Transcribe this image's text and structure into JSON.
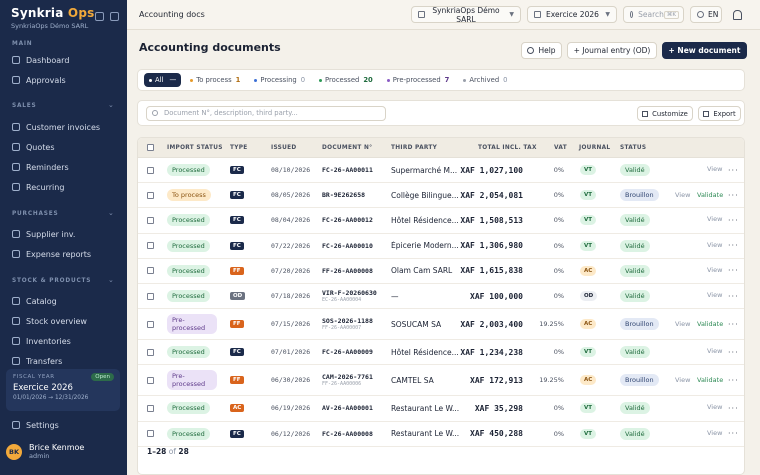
{
  "brand": {
    "name_a": "Synkria",
    "name_b": "Ops",
    "org": "SynkriaOps Démo SARL"
  },
  "sidebar": {
    "sections": [
      {
        "label": "MAIN"
      },
      {
        "label": "SALES"
      },
      {
        "label": "PURCHASES"
      },
      {
        "label": "STOCK & PRODUCTS"
      }
    ],
    "items": [
      {
        "label": "Dashboard",
        "icon": "grid-icon"
      },
      {
        "label": "Approvals",
        "icon": "check-icon"
      },
      {
        "label": "Customer invoices",
        "icon": "file-icon"
      },
      {
        "label": "Quotes",
        "icon": "quote-icon"
      },
      {
        "label": "Reminders",
        "icon": "bell-icon"
      },
      {
        "label": "Recurring",
        "icon": "repeat-icon"
      },
      {
        "label": "Supplier inv.",
        "icon": "file-icon"
      },
      {
        "label": "Expense reports",
        "icon": "receipt-icon"
      },
      {
        "label": "Catalog",
        "icon": "box-icon"
      },
      {
        "label": "Stock overview",
        "icon": "layers-icon"
      },
      {
        "label": "Inventories",
        "icon": "clipboard-icon"
      },
      {
        "label": "Transfers",
        "icon": "transfer-icon"
      },
      {
        "label": "Settings",
        "icon": "gear-icon"
      }
    ],
    "fiscal": {
      "label": "FISCAL YEAR",
      "name": "Exercice 2026",
      "dates": "01/01/2026 → 12/31/2026",
      "badge": "Open"
    },
    "user": {
      "initials": "BK",
      "name": "Brice Kenmoe",
      "role": "admin"
    }
  },
  "topbar": {
    "breadcrumb": "Accounting docs",
    "company": "SynkriaOps Démo SARL",
    "year": "Exercice 2026",
    "search_placeholder": "Search",
    "search_kbd": "⌘K",
    "lang": "EN"
  },
  "page": {
    "title": "Accounting documents",
    "help": "Help",
    "journal_entry": "+ Journal entry (OD)",
    "new_document": "+ New document"
  },
  "tabs": [
    {
      "label": "All",
      "count": "",
      "color": "#ffffff"
    },
    {
      "label": "To process",
      "count": "1",
      "color": "#e59a2a"
    },
    {
      "label": "Processing",
      "count": "0",
      "color": "#3b6fd6"
    },
    {
      "label": "Processed",
      "count": "20",
      "color": "#2e9a57"
    },
    {
      "label": "Pre-processed",
      "count": "7",
      "color": "#8a5bc4"
    },
    {
      "label": "Archived",
      "count": "0",
      "color": "#9aa0ab"
    }
  ],
  "filters": {
    "search_placeholder": "Document N°, description, third party...",
    "customize": "Customize",
    "export": "Export"
  },
  "table": {
    "headers": {
      "import_status": "IMPORT STATUS",
      "type": "TYPE",
      "issued": "ISSUED",
      "document": "DOCUMENT N°",
      "third_party": "THIRD PARTY",
      "total": "TOTAL INCL. TAX",
      "vat": "VAT",
      "journal": "JOURNAL",
      "status": "STATUS"
    },
    "rows": [
      {
        "import": "Processed",
        "import_kind": "processed",
        "type": "FC",
        "type_color": "#1b2a4a",
        "issued": "08/10/2026",
        "doc": "FC-26-AA00011",
        "doc_sub": "",
        "third": "Supermarché M...",
        "total": "XAF 1,027,100",
        "vat": "0%",
        "journal": "VT",
        "journal_kind": "vt",
        "status": "Validé",
        "status_kind": "valide",
        "actions": [
          "View"
        ]
      },
      {
        "import": "To process",
        "import_kind": "toprocess",
        "type": "FC",
        "type_color": "#1b2a4a",
        "issued": "08/05/2026",
        "doc": "BR-9E262658",
        "doc_sub": "",
        "third": "Collège Bilingue...",
        "total": "XAF 2,054,081",
        "vat": "0%",
        "journal": "VT",
        "journal_kind": "vt",
        "status": "Brouillon",
        "status_kind": "brouillon",
        "actions": [
          "View",
          "Validate"
        ]
      },
      {
        "import": "Processed",
        "import_kind": "processed",
        "type": "FC",
        "type_color": "#1b2a4a",
        "issued": "08/04/2026",
        "doc": "FC-26-AA00012",
        "doc_sub": "",
        "third": "Hôtel Résidence...",
        "total": "XAF 1,508,513",
        "vat": "0%",
        "journal": "VT",
        "journal_kind": "vt",
        "status": "Validé",
        "status_kind": "valide",
        "actions": [
          "View"
        ]
      },
      {
        "import": "Processed",
        "import_kind": "processed",
        "type": "FC",
        "type_color": "#1b2a4a",
        "issued": "07/22/2026",
        "doc": "FC-26-AA00010",
        "doc_sub": "",
        "third": "Épicerie Modern...",
        "total": "XAF 1,306,980",
        "vat": "0%",
        "journal": "VT",
        "journal_kind": "vt",
        "status": "Validé",
        "status_kind": "valide",
        "actions": [
          "View"
        ]
      },
      {
        "import": "Processed",
        "import_kind": "processed",
        "type": "FF",
        "type_color": "#d9641c",
        "issued": "07/20/2026",
        "doc": "FF-26-AA00008",
        "doc_sub": "",
        "third": "Olam Cam SARL",
        "total": "XAF 1,615,838",
        "vat": "0%",
        "journal": "AC",
        "journal_kind": "ac",
        "status": "Validé",
        "status_kind": "valide",
        "actions": [
          "View"
        ]
      },
      {
        "import": "Processed",
        "import_kind": "processed",
        "type": "OD",
        "type_color": "#6b7280",
        "issued": "07/18/2026",
        "doc": "VIR-F-20260630",
        "doc_sub": "EC-26-AA00004",
        "third": "—",
        "total": "XAF 100,000",
        "vat": "0%",
        "journal": "OD",
        "journal_kind": "od",
        "status": "Validé",
        "status_kind": "valide",
        "actions": [
          "View"
        ]
      },
      {
        "import": "Pre-processed",
        "import_kind": "preproc",
        "type": "FF",
        "type_color": "#d9641c",
        "issued": "07/15/2026",
        "doc": "SOS-2026-1188",
        "doc_sub": "FF-26-AA00007",
        "third": "SOSUCAM SA",
        "total": "XAF 2,003,400",
        "vat": "19.25%",
        "journal": "AC",
        "journal_kind": "ac",
        "status": "Brouillon",
        "status_kind": "brouillon",
        "actions": [
          "View",
          "Validate"
        ]
      },
      {
        "import": "Processed",
        "import_kind": "processed",
        "type": "FC",
        "type_color": "#1b2a4a",
        "issued": "07/01/2026",
        "doc": "FC-26-AA00009",
        "doc_sub": "",
        "third": "Hôtel Résidence...",
        "total": "XAF 1,234,238",
        "vat": "0%",
        "journal": "VT",
        "journal_kind": "vt",
        "status": "Validé",
        "status_kind": "valide",
        "actions": [
          "View"
        ]
      },
      {
        "import": "Pre-processed",
        "import_kind": "preproc",
        "type": "FF",
        "type_color": "#d9641c",
        "issued": "06/30/2026",
        "doc": "CAM-2026-7761",
        "doc_sub": "FF-26-AA00006",
        "third": "CAMTEL SA",
        "total": "XAF 172,913",
        "vat": "19.25%",
        "journal": "AC",
        "journal_kind": "ac",
        "status": "Brouillon",
        "status_kind": "brouillon",
        "actions": [
          "View",
          "Validate"
        ]
      },
      {
        "import": "Processed",
        "import_kind": "processed",
        "type": "AC",
        "type_color": "#d9641c",
        "issued": "06/19/2026",
        "doc": "AV-26-AA00001",
        "doc_sub": "",
        "third": "Restaurant Le W...",
        "total": "XAF 35,298",
        "vat": "0%",
        "journal": "VT",
        "journal_kind": "vt",
        "status": "Validé",
        "status_kind": "valide",
        "actions": [
          "View"
        ]
      },
      {
        "import": "Processed",
        "import_kind": "processed",
        "type": "FC",
        "type_color": "#1b2a4a",
        "issued": "06/12/2026",
        "doc": "FC-26-AA00008",
        "doc_sub": "",
        "third": "Restaurant Le W...",
        "total": "XAF 450,288",
        "vat": "0%",
        "journal": "VT",
        "journal_kind": "vt",
        "status": "Validé",
        "status_kind": "valide",
        "actions": [
          "View"
        ]
      }
    ]
  },
  "pagination": {
    "range": "1–28",
    "of": "of",
    "total": "28"
  },
  "colors": {
    "journal_vt_bg": "#dcf3e4",
    "journal_vt_fg": "#1f6b3d",
    "journal_ac_bg": "#fde9c8",
    "journal_ac_fg": "#8a5412",
    "journal_od_bg": "#eceef2",
    "journal_od_fg": "#1b2233"
  }
}
